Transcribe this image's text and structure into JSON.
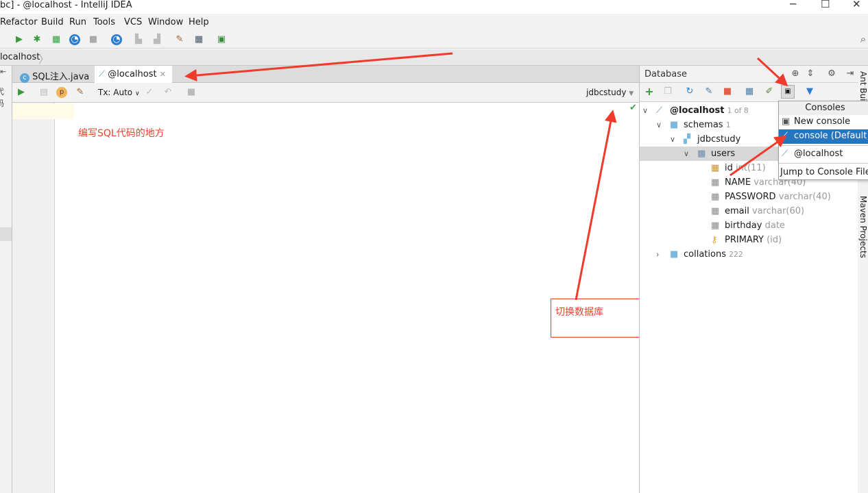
{
  "window": {
    "title": "bc] - @localhost - IntelliJ IDEA",
    "controls": [
      "minimize",
      "maximize",
      "close"
    ]
  },
  "menu": [
    "Refactor",
    "Build",
    "Run",
    "Tools",
    "VCS",
    "Window",
    "Help"
  ],
  "breadcrumb": "localhost",
  "left_strip_text": "代码",
  "tabs": [
    {
      "label": "SQL注入.java",
      "icon": "java-class-icon",
      "active": false
    },
    {
      "label": "@localhost",
      "icon": "mysql-dolphin-icon",
      "active": true
    }
  ],
  "editor_toolbar": {
    "tx_mode": "Tx: Auto",
    "schema": "jdbcstudy"
  },
  "editor": {
    "annotation": "编写SQL代码的地方"
  },
  "annotation_box": "切换数据库",
  "database": {
    "title": "Database",
    "tree": [
      {
        "label": "@localhost",
        "extra": "1 of 8",
        "level": 0,
        "expanded": true,
        "icon": "mysql-dolphin-icon"
      },
      {
        "label": "schemas",
        "extra": "1",
        "level": 1,
        "expanded": true,
        "icon": "folder-icon"
      },
      {
        "label": "jdbcstudy",
        "extra": "",
        "level": 2,
        "expanded": true,
        "icon": "schema-icon"
      },
      {
        "label": "users",
        "extra": "",
        "level": 3,
        "expanded": true,
        "icon": "table-icon",
        "selected": true
      },
      {
        "label": "id",
        "extra": "int(11)",
        "level": 4,
        "icon": "key-column-icon"
      },
      {
        "label": "NAME",
        "extra": "varchar(40)",
        "level": 4,
        "icon": "column-icon"
      },
      {
        "label": "PASSWORD",
        "extra": "varchar(40)",
        "level": 4,
        "icon": "column-icon"
      },
      {
        "label": "email",
        "extra": "varchar(60)",
        "level": 4,
        "icon": "column-icon"
      },
      {
        "label": "birthday",
        "extra": "date",
        "level": 4,
        "icon": "column-icon"
      },
      {
        "label": "PRIMARY",
        "extra": "(id)",
        "level": 4,
        "icon": "key-icon"
      },
      {
        "label": "collations",
        "extra": "222",
        "level": 1,
        "expanded": false,
        "icon": "folder-icon"
      }
    ]
  },
  "consoles_popup": {
    "title": "Consoles",
    "items": [
      "New console",
      "console (Default)",
      "@localhost",
      "Jump to Console Files"
    ],
    "selected": "console (Default)"
  },
  "right_strip": [
    "Ant Build",
    "Maven Projects"
  ],
  "colors": {
    "accent": "#2675bf",
    "annotation_red": "#e8432f",
    "run_green": "#3a9a3a"
  }
}
